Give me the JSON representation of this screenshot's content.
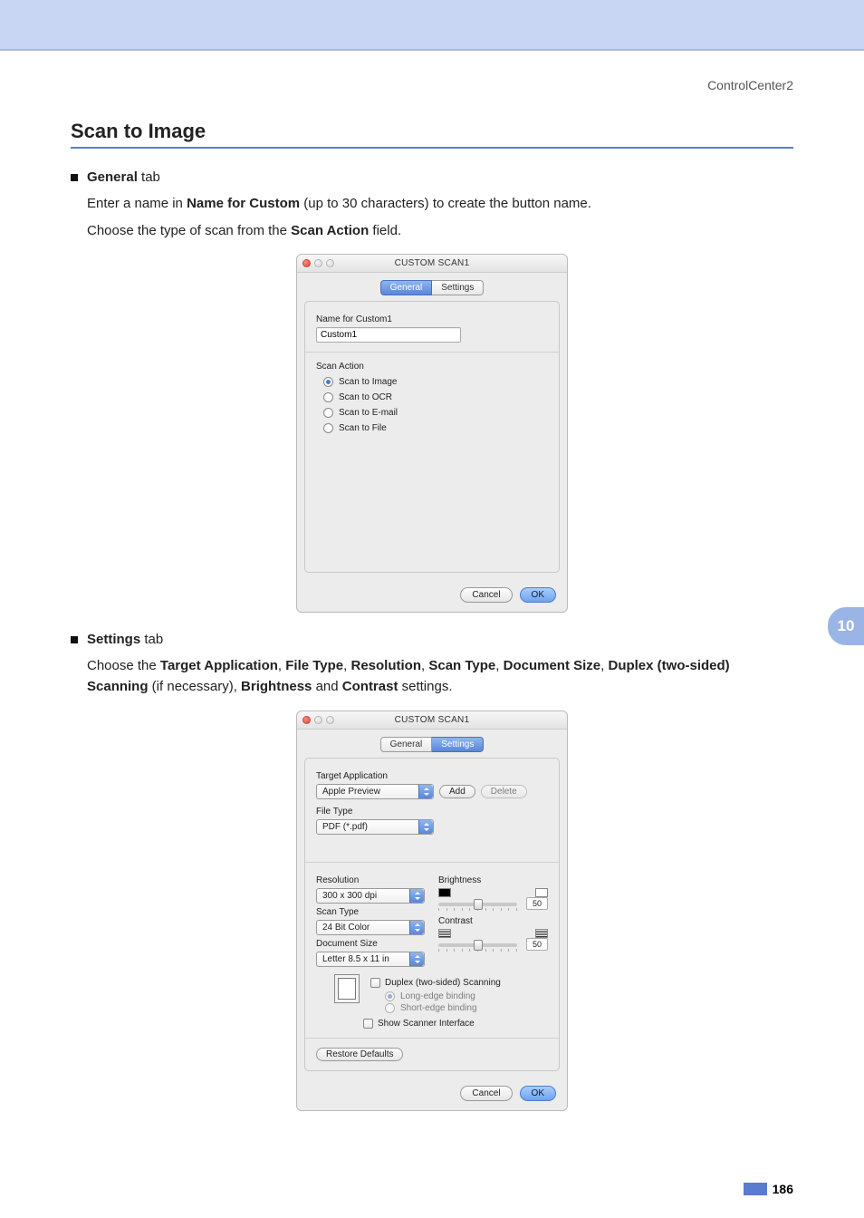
{
  "header_right": "ControlCenter2",
  "section_title": "Scan to Image",
  "bullet1_bold": "General",
  "bullet1_rest": " tab",
  "para1a": "Enter a name in ",
  "para1b_bold": "Name for Custom",
  "para1c": " (up to 30 characters) to create the button name.",
  "para2a": "Choose the type of scan from the ",
  "para2b_bold": "Scan Action",
  "para2c": " field.",
  "dlg1": {
    "title": "CUSTOM SCAN1",
    "tab_general": "General",
    "tab_settings": "Settings",
    "name_label": "Name for Custom1",
    "name_value": "Custom1",
    "scan_action_label": "Scan Action",
    "opts": [
      "Scan to Image",
      "Scan to OCR",
      "Scan to E-mail",
      "Scan to File"
    ],
    "cancel": "Cancel",
    "ok": "OK"
  },
  "bullet2_bold": "Settings",
  "bullet2_rest": " tab",
  "para3": {
    "a": "Choose the ",
    "b1": "Target Application",
    "c1": ", ",
    "b2": "File Type",
    "c2": ", ",
    "b3": "Resolution",
    "c3": ", ",
    "b4": "Scan Type",
    "c4": ", ",
    "b5": "Document Size",
    "c5": ", ",
    "b6": "Duplex (two-sided) Scanning",
    "c6": " (if necessary), ",
    "b7": "Brightness",
    "c7": " and ",
    "b8": "Contrast",
    "c8": " settings."
  },
  "dlg2": {
    "title": "CUSTOM SCAN1",
    "tab_general": "General",
    "tab_settings": "Settings",
    "target_label": "Target Application",
    "target_value": "Apple Preview",
    "add": "Add",
    "delete": "Delete",
    "filetype_label": "File Type",
    "filetype_value": "PDF (*.pdf)",
    "resolution_label": "Resolution",
    "resolution_value": "300 x 300 dpi",
    "scantype_label": "Scan Type",
    "scantype_value": "24 Bit Color",
    "docsize_label": "Document Size",
    "docsize_value": "Letter  8.5 x 11 in",
    "brightness_label": "Brightness",
    "brightness_value": "50",
    "contrast_label": "Contrast",
    "contrast_value": "50",
    "duplex_label": "Duplex (two-sided) Scanning",
    "long_edge": "Long-edge binding",
    "short_edge": "Short-edge binding",
    "show_scanner": "Show Scanner Interface",
    "restore": "Restore Defaults",
    "cancel": "Cancel",
    "ok": "OK"
  },
  "side_tab": "10",
  "page_number": "186"
}
